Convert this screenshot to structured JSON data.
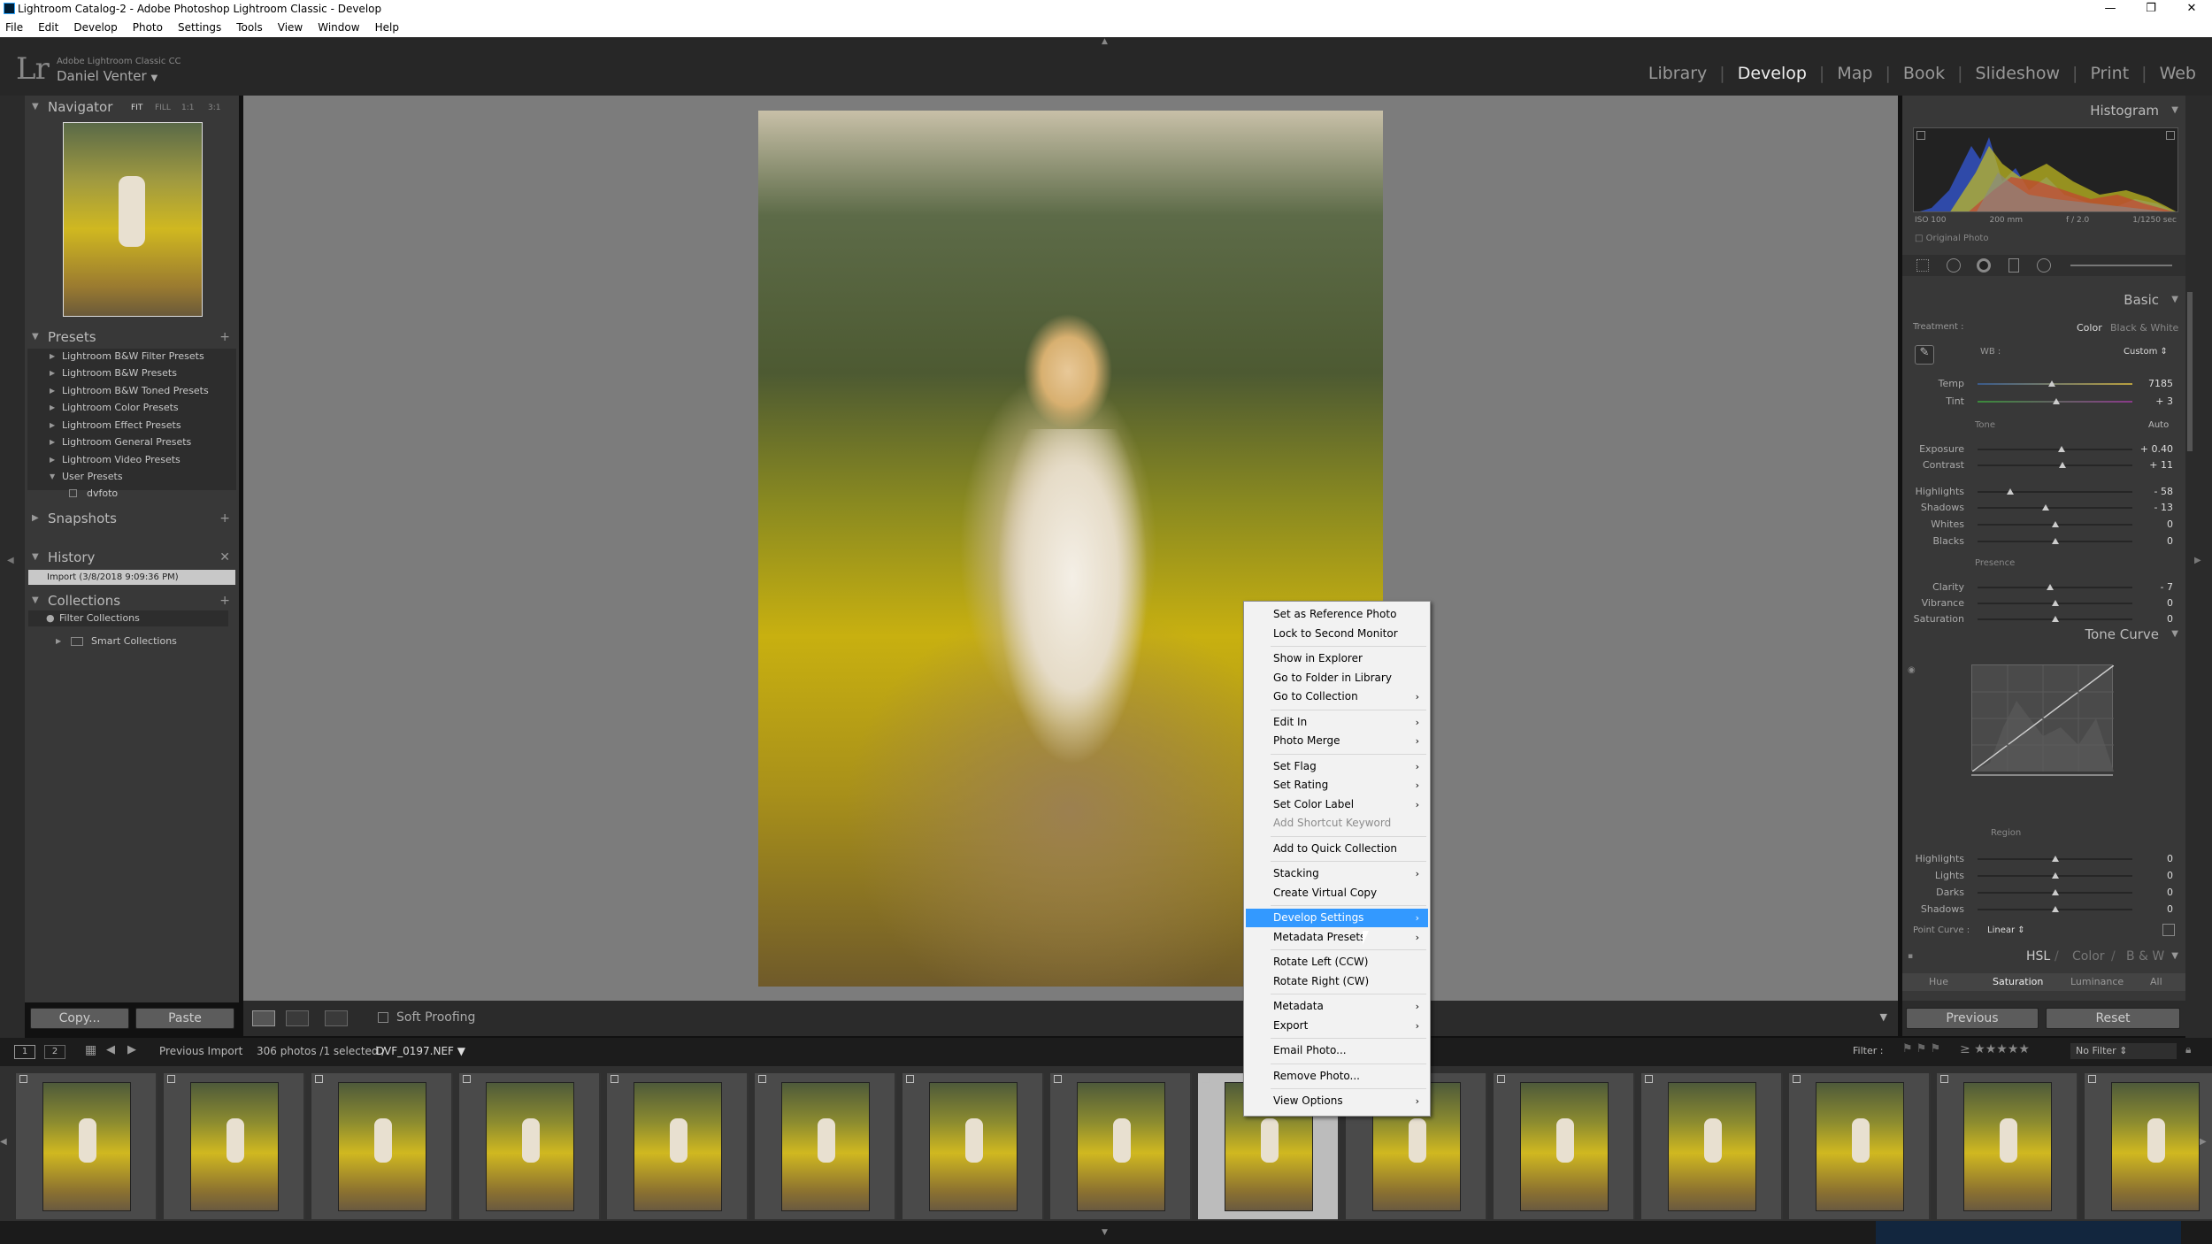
{
  "window": {
    "title": "Lightroom Catalog-2 - Adobe Photoshop Lightroom Classic - Develop",
    "controls": [
      "—",
      "❐",
      "✕"
    ]
  },
  "menubar": [
    "File",
    "Edit",
    "Develop",
    "Photo",
    "Settings",
    "Tools",
    "View",
    "Window",
    "Help"
  ],
  "identity": {
    "product": "Adobe Lightroom Classic CC",
    "user": "Daniel Venter",
    "logo": "Lr"
  },
  "modules": [
    "Library",
    "Develop",
    "Map",
    "Book",
    "Slideshow",
    "Print",
    "Web"
  ],
  "navigator": {
    "title": "Navigator",
    "zoom": [
      "FIT",
      "FILL",
      "1:1",
      "3:1"
    ]
  },
  "presets": {
    "title": "Presets",
    "items": [
      "Lightroom B&W Filter Presets",
      "Lightroom B&W Presets",
      "Lightroom B&W Toned Presets",
      "Lightroom Color Presets",
      "Lightroom Effect Presets",
      "Lightroom General Presets",
      "Lightroom Video Presets",
      "User Presets"
    ],
    "user_child": "dvfoto"
  },
  "snapshots": {
    "title": "Snapshots"
  },
  "history": {
    "title": "History",
    "items": [
      "Import (3/8/2018 9:09:36 PM)"
    ]
  },
  "collections": {
    "title": "Collections",
    "items": [
      "Filter Collections",
      "Smart Collections"
    ]
  },
  "left_buttons": {
    "copy": "Copy...",
    "paste": "Paste"
  },
  "toolbar": {
    "soft_proofing": "Soft Proofing"
  },
  "filmstrip_bar": {
    "pages": [
      "1",
      "2"
    ],
    "source": "Previous Import",
    "count": "306 photos /1 selected /",
    "filename": "DVF_0197.NEF",
    "filter_label": "Filter :",
    "filter_value": "No Filter"
  },
  "histogram": {
    "title": "Histogram",
    "iso": "ISO 100",
    "focal": "200 mm",
    "aperture": "f / 2.0",
    "shutter": "1/1250 sec",
    "original": "Original Photo"
  },
  "basic": {
    "title": "Basic",
    "treatment_label": "Treatment :",
    "color": "Color",
    "bw": "Black & White",
    "wb_label": "WB :",
    "wb_value": "Custom",
    "tone": "Tone",
    "auto": "Auto",
    "presence": "Presence",
    "sliders": [
      {
        "label": "Temp",
        "value": "7185",
        "pos": 0.48
      },
      {
        "label": "Tint",
        "value": "+ 3",
        "pos": 0.51
      },
      {
        "label": "Exposure",
        "value": "+ 0.40",
        "pos": 0.54
      },
      {
        "label": "Contrast",
        "value": "+ 11",
        "pos": 0.55
      },
      {
        "label": "Highlights",
        "value": "- 58",
        "pos": 0.21
      },
      {
        "label": "Shadows",
        "value": "- 13",
        "pos": 0.44
      },
      {
        "label": "Whites",
        "value": "0",
        "pos": 0.5
      },
      {
        "label": "Blacks",
        "value": "0",
        "pos": 0.5
      },
      {
        "label": "Clarity",
        "value": "- 7",
        "pos": 0.47
      },
      {
        "label": "Vibrance",
        "value": "0",
        "pos": 0.5
      },
      {
        "label": "Saturation",
        "value": "0",
        "pos": 0.5
      }
    ]
  },
  "tone_curve": {
    "title": "Tone Curve",
    "region": "Region",
    "point_curve_label": "Point Curve :",
    "point_curve_value": "Linear",
    "sliders": [
      {
        "label": "Highlights",
        "value": "0"
      },
      {
        "label": "Lights",
        "value": "0"
      },
      {
        "label": "Darks",
        "value": "0"
      },
      {
        "label": "Shadows",
        "value": "0"
      }
    ]
  },
  "hsl": {
    "tabs": [
      "HSL",
      "Color",
      "B & W"
    ],
    "sub": [
      "Hue",
      "Saturation",
      "Luminance",
      "All"
    ]
  },
  "right_buttons": {
    "previous": "Previous",
    "reset": "Reset"
  },
  "context_menu": [
    {
      "label": "Set as Reference Photo"
    },
    {
      "label": "Lock to Second Monitor"
    },
    {
      "sep": true
    },
    {
      "label": "Show in Explorer"
    },
    {
      "label": "Go to Folder in Library"
    },
    {
      "label": "Go to Collection",
      "sub": true
    },
    {
      "sep": true
    },
    {
      "label": "Edit In",
      "sub": true
    },
    {
      "label": "Photo Merge",
      "sub": true
    },
    {
      "sep": true
    },
    {
      "label": "Set Flag",
      "sub": true
    },
    {
      "label": "Set Rating",
      "sub": true
    },
    {
      "label": "Set Color Label",
      "sub": true
    },
    {
      "label": "Add Shortcut Keyword",
      "disabled": true
    },
    {
      "sep": true
    },
    {
      "label": "Add to Quick Collection"
    },
    {
      "sep": true
    },
    {
      "label": "Stacking",
      "sub": true
    },
    {
      "label": "Create Virtual Copy"
    },
    {
      "sep": true
    },
    {
      "label": "Develop Settings",
      "sub": true,
      "highlight": true
    },
    {
      "label": "Metadata Presets",
      "sub": true
    },
    {
      "sep": true
    },
    {
      "label": "Rotate Left (CCW)"
    },
    {
      "label": "Rotate Right (CW)"
    },
    {
      "sep": true
    },
    {
      "label": "Metadata",
      "sub": true
    },
    {
      "label": "Export",
      "sub": true
    },
    {
      "sep": true
    },
    {
      "label": "Email Photo..."
    },
    {
      "sep": true
    },
    {
      "label": "Remove Photo..."
    },
    {
      "sep": true
    },
    {
      "label": "View Options",
      "sub": true
    }
  ],
  "filmstrip": {
    "count": 15,
    "selected_index": 8
  }
}
